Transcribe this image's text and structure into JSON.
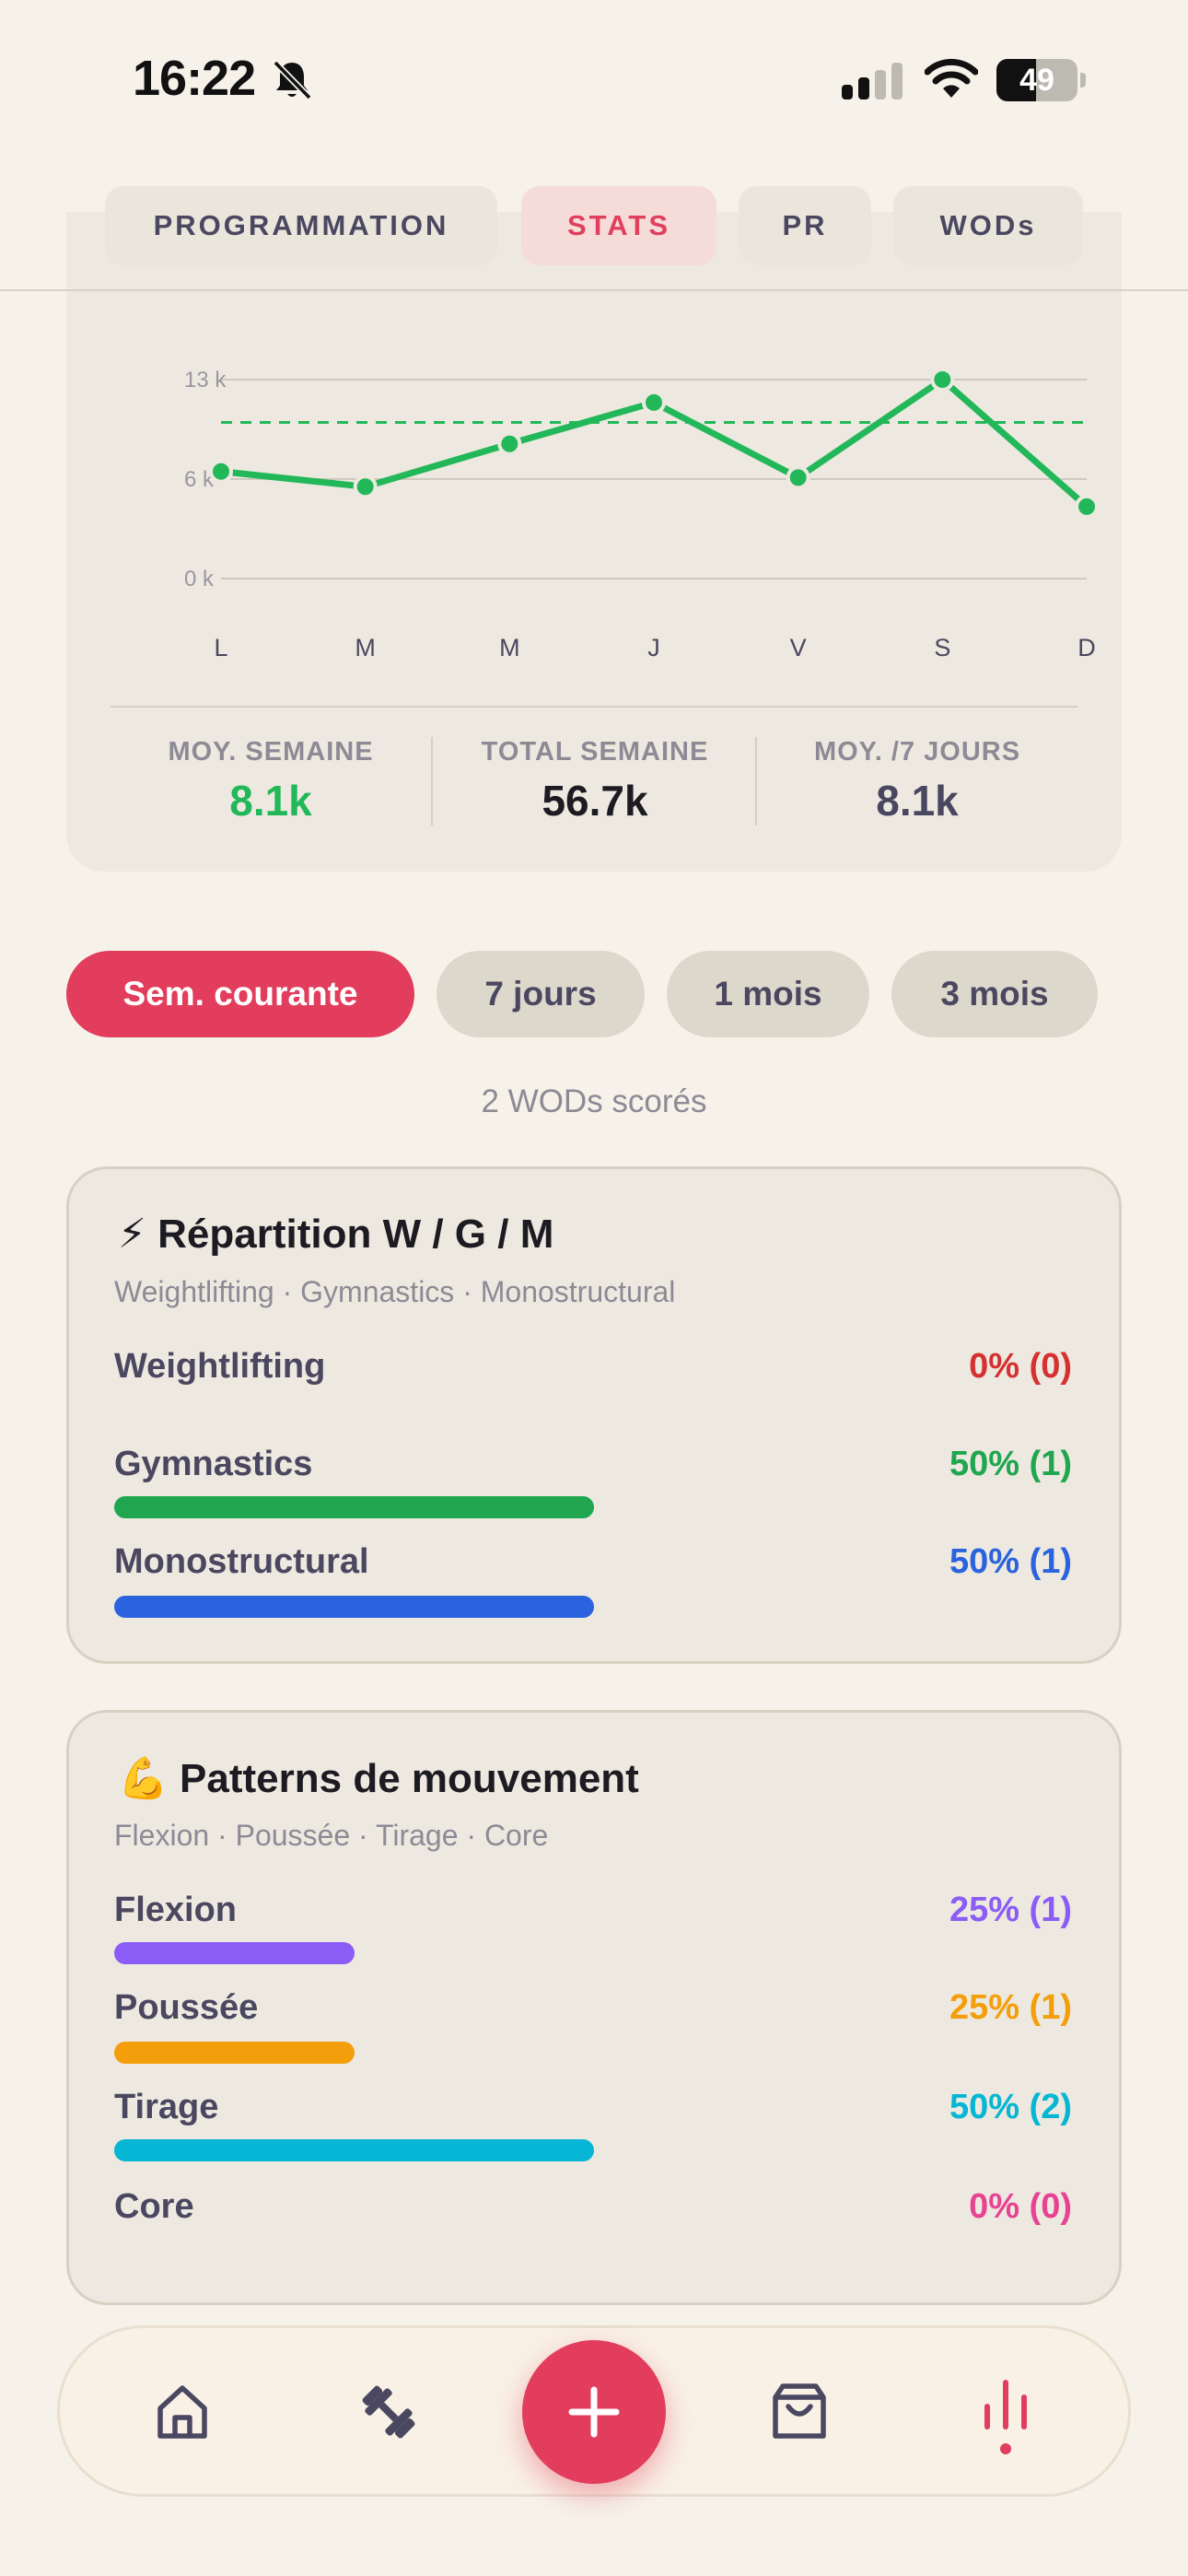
{
  "status_bar": {
    "time": "16:22",
    "battery": "49",
    "battery_level": 0.49
  },
  "top_tabs": [
    {
      "label": "PROGRAMMATION",
      "active": false
    },
    {
      "label": "STATS",
      "active": true
    },
    {
      "label": "PR",
      "active": false
    },
    {
      "label": "WODs",
      "active": false
    }
  ],
  "chart_data": {
    "type": "line",
    "categories": [
      "L",
      "M",
      "M",
      "J",
      "V",
      "S",
      "D"
    ],
    "series": [
      {
        "values": [
          7000,
          6000,
          8800,
          11500,
          6600,
          13000,
          4700
        ],
        "color": "#22b859"
      }
    ],
    "reference_line": {
      "value": 10200,
      "style": "dashed",
      "color": "#22b859"
    },
    "y_ticks": [
      {
        "value": 0,
        "label": "0 k"
      },
      {
        "value": 6500,
        "label": "6 k"
      },
      {
        "value": 13000,
        "label": "13 k"
      }
    ],
    "ylim": [
      0,
      13000
    ],
    "grid": true
  },
  "summary": [
    {
      "label": "MOY. SEMAINE",
      "value": "8.1k",
      "color": "#22b859"
    },
    {
      "label": "TOTAL SEMAINE",
      "value": "56.7k",
      "color": "#1c1b22"
    },
    {
      "label": "MOY. /7 JOURS",
      "value": "8.1k",
      "color": "#4a4760"
    }
  ],
  "periods": [
    {
      "label": "Sem. courante",
      "active": true
    },
    {
      "label": "7 jours",
      "active": false
    },
    {
      "label": "1 mois",
      "active": false
    },
    {
      "label": "3 mois",
      "active": false
    }
  ],
  "wods_scored": "2 WODs scorés",
  "split_card": {
    "emoji": "⚡",
    "title": "Répartition W / G / M",
    "subtitle": "Weightlifting · Gymnastics · Monostructural",
    "rows": [
      {
        "label": "Weightlifting",
        "value": "0% (0)",
        "percent": 0,
        "color": "#d63031"
      },
      {
        "label": "Gymnastics",
        "value": "50% (1)",
        "percent": 50,
        "color": "#1fa64f"
      },
      {
        "label": "Monostructural",
        "value": "50% (1)",
        "percent": 50,
        "color": "#2b63de"
      }
    ]
  },
  "patterns_card": {
    "emoji": "💪",
    "title": "Patterns de mouvement",
    "subtitle": "Flexion · Poussée · Tirage · Core",
    "rows": [
      {
        "label": "Flexion",
        "value": "25% (1)",
        "percent": 25,
        "color": "#8b5cf6"
      },
      {
        "label": "Poussée",
        "value": "25% (1)",
        "percent": 25,
        "color": "#f59e0b"
      },
      {
        "label": "Tirage",
        "value": "50% (2)",
        "percent": 50,
        "color": "#06b6d4"
      },
      {
        "label": "Core",
        "value": "0% (0)",
        "percent": 0,
        "color": "#e84393"
      }
    ]
  },
  "nav": {
    "items": [
      "home-icon",
      "dumbbell-icon",
      "add-icon",
      "bag-icon",
      "stats-icon"
    ],
    "active": "stats-icon",
    "accent": "#e23d5c"
  }
}
